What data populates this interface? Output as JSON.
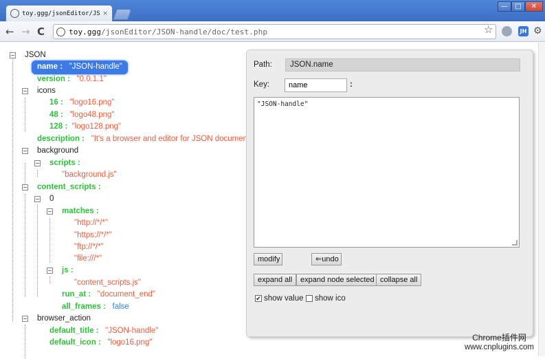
{
  "tab": {
    "title": "toy.ggg/jsonEditor/JSON-",
    "close": "×"
  },
  "window_controls": {
    "minimize": "—",
    "maximize": "□",
    "close": "✕"
  },
  "toolbar": {
    "url_host": "toy.ggg",
    "url_path": "/jsonEditor/JSON-handle/doc/test.php",
    "back": "←",
    "forward": "→",
    "reload": "C",
    "star": "☆",
    "wrench": "🔧",
    "ext2_label": "JH"
  },
  "tree": {
    "root": "JSON",
    "name_key": "name :",
    "name_val": "\"JSON-handle\"",
    "version_key": "version :",
    "version_val": "\"0.0.1.1\"",
    "icons": "icons",
    "i16_key": "16 :",
    "i16_val": "\"logo16.png\"",
    "i48_key": "48 :",
    "i48_val": "\"logo48.png\"",
    "i128_key": "128 :",
    "i128_val": "\"logo128.png\"",
    "desc_key": "description :",
    "desc_val": "\"It's a browser and editor for JSON document.",
    "background": "background",
    "scripts_key": "scripts :",
    "scripts_item": "\"background.js\"",
    "cs_key": "content_scripts :",
    "idx0": "0",
    "matches_key": "matches :",
    "m1": "\"http://*/*\"",
    "m2": "\"https://*/*\"",
    "m3": "\"ftp://*/*\"",
    "m4": "\"file:///*\"",
    "js_key": "js :",
    "js_item": "\"content_scripts.js\"",
    "runat_key": "run_at :",
    "runat_val": "\"document_end\"",
    "allframes_key": "all_frames :",
    "allframes_val": "false",
    "ba": "browser_action",
    "dt_key": "default_title :",
    "dt_val": "\"JSON-handle\"",
    "di_key": "default_icon :",
    "di_val": "\"logo16.png\""
  },
  "panel": {
    "path_label": "Path:",
    "path_value": "JSON.name",
    "key_label": "Key:",
    "key_value": "name",
    "colon": ":",
    "text_value": "\"JSON-handle\"",
    "modify": "modify",
    "undo": "⇐undo",
    "expand_all": "expand all",
    "expand_selected": "expand node selected",
    "collapse_all": "collapse all",
    "show_value": "show value",
    "show_value_checked": "✔",
    "show_ico": "show ico"
  },
  "watermark": {
    "line1": "Chrome插件网",
    "line2": "www.cnplugins.com"
  },
  "colors": {
    "key": "#2ec23a",
    "string": "#ef5a3a",
    "bool": "#3a7fd6",
    "selected": "#3c7ae6"
  }
}
